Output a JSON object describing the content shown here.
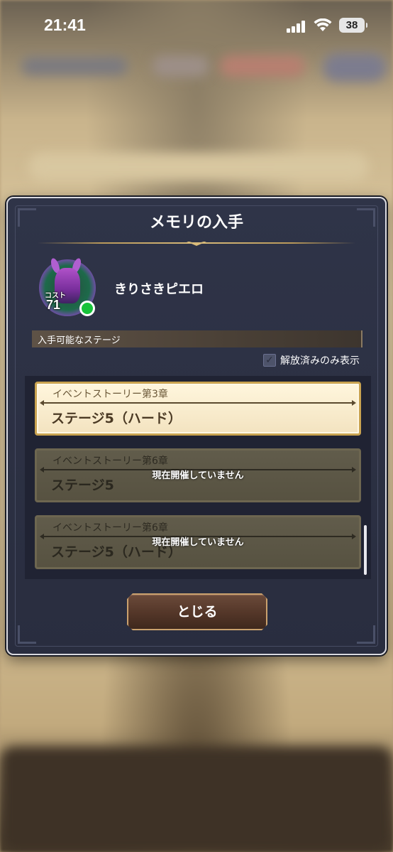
{
  "status_bar": {
    "time": "21:41",
    "battery": "38"
  },
  "dialog": {
    "title": "メモリの入手",
    "monster": {
      "cost_label": "コスト",
      "cost_value": "71",
      "name": "きりさきピエロ"
    },
    "section_header": "入手可能なステージ",
    "filter_label": "解放済みのみ表示",
    "stages": [
      {
        "chapter": "イベントストーリー第3章",
        "title": "ステージ5（ハード）",
        "overlay": ""
      },
      {
        "chapter": "イベントストーリー第6章",
        "title": "ステージ5",
        "overlay": "現在開催していません"
      },
      {
        "chapter": "イベントストーリー第6章",
        "title": "ステージ5（ハード）",
        "overlay": "現在開催していません"
      }
    ],
    "close_label": "とじる"
  },
  "colors": {
    "dialog_bg": "#2f3448",
    "active_stage_bg": "#fff6dd",
    "active_stage_border": "#c9a350",
    "disabled_stage_bg": "#615c4b",
    "online_dot": "#17c23a",
    "close_button": "#533628"
  }
}
